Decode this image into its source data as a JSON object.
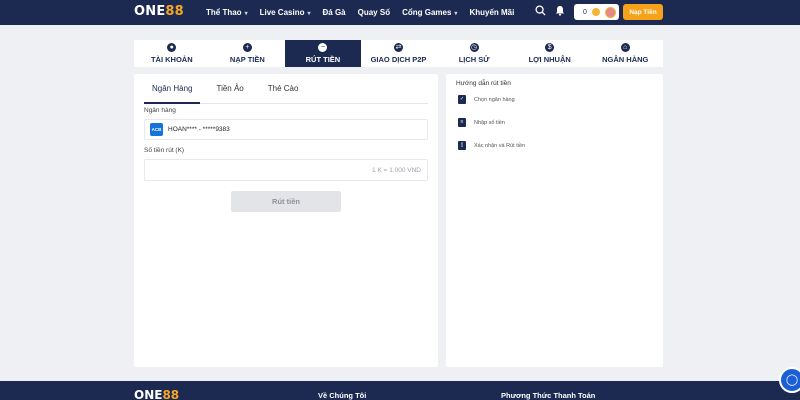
{
  "brand": {
    "logo_main": "ONE",
    "logo_accent": "88"
  },
  "nav": {
    "items": [
      {
        "label": "Thể Thao",
        "dropdown": true
      },
      {
        "label": "Live Casino",
        "dropdown": true
      },
      {
        "label": "Đá Gà",
        "dropdown": false
      },
      {
        "label": "Quay Số",
        "dropdown": false
      },
      {
        "label": "Cổng Games",
        "dropdown": true
      },
      {
        "label": "Khuyến Mãi",
        "dropdown": false
      }
    ],
    "balance": "0",
    "deposit_label": "Nạp Tiền",
    "icons": [
      "search-icon",
      "bell-icon"
    ]
  },
  "tabs": [
    {
      "label": "TÀI KHOẢN",
      "icon": "user-icon",
      "active": false
    },
    {
      "label": "NẠP TIỀN",
      "icon": "plus-icon",
      "active": false
    },
    {
      "label": "RÚT TIỀN",
      "icon": "minus-icon",
      "active": true
    },
    {
      "label": "GIAO DỊCH P2P",
      "icon": "transfer-icon",
      "active": false
    },
    {
      "label": "LỊCH SỬ",
      "icon": "clock-icon",
      "active": false
    },
    {
      "label": "LỢI NHUẬN",
      "icon": "coin-icon",
      "active": false
    },
    {
      "label": "NGÂN HÀNG",
      "icon": "bank-icon",
      "active": false
    }
  ],
  "withdraw": {
    "subtabs": [
      {
        "label": "Ngân Hàng",
        "active": true
      },
      {
        "label": "Tiền Ảo",
        "active": false
      },
      {
        "label": "Thẻ Cào",
        "active": false
      }
    ],
    "bank_label": "Ngân hàng",
    "bank_logo": "ACB",
    "bank_account": "HOAN**** - *****9383",
    "amount_label": "Số tiền rút (K)",
    "amount_placeholder": "1 K = 1.000 VND",
    "submit_label": "Rút tiền"
  },
  "guide": {
    "title": "Hướng dẫn rút tiền",
    "steps": [
      {
        "text": "Chọn ngân hàng"
      },
      {
        "text": "Nhập số tiền"
      },
      {
        "text": "Xác nhận và Rút tiền"
      }
    ]
  },
  "footer": {
    "logo_main": "ONE",
    "logo_accent": "88",
    "about_heading": "Về Chúng Tôi",
    "payment_heading": "Phương Thức Thanh Toán"
  },
  "colors": {
    "navy": "#1c2a52",
    "accent": "#f6a21a",
    "chat": "#1b5fd6"
  }
}
